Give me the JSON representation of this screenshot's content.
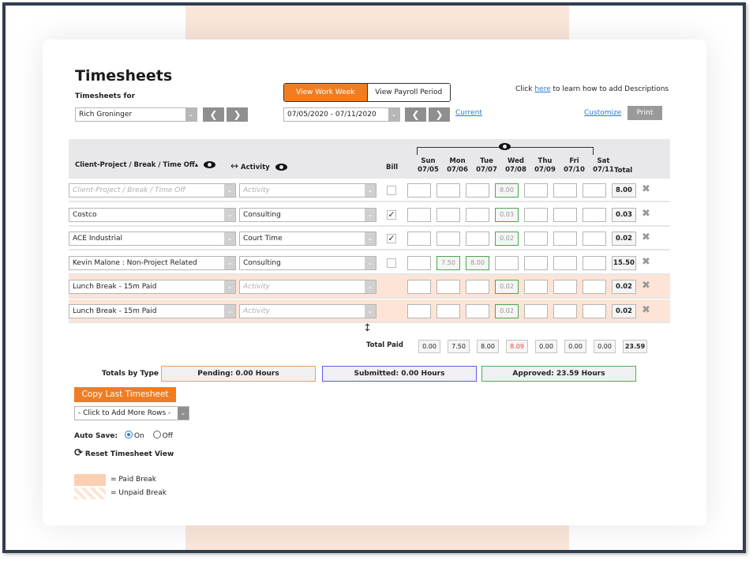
{
  "page": {
    "title": "Timesheets",
    "timesheets_for_label": "Timesheets for",
    "employee_selected": "Rich Groninger",
    "view_toggle": {
      "work_week": "View Work Week",
      "payroll_period": "View Payroll Period",
      "active": "work_week"
    },
    "date_range": "07/05/2020 - 07/11/2020",
    "current_link": "Current",
    "help": {
      "prefix": "Click",
      "link": "here",
      "suffix": "to learn how to add Descriptions"
    },
    "customize_link": "Customize",
    "print_label": "Print"
  },
  "grid": {
    "headers": {
      "client_project": "Client-Project / Break / Time Off",
      "sort_indicator": "▴",
      "activity": "Activity",
      "bill": "Bill",
      "total": "Total",
      "days": [
        {
          "day": "Sun",
          "date": "07/05"
        },
        {
          "day": "Mon",
          "date": "07/06"
        },
        {
          "day": "Tue",
          "date": "07/07"
        },
        {
          "day": "Wed",
          "date": "07/08"
        },
        {
          "day": "Thu",
          "date": "07/09"
        },
        {
          "day": "Fri",
          "date": "07/10"
        },
        {
          "day": "Sat",
          "date": "07/11"
        }
      ]
    },
    "placeholders": {
      "client_project": "Client-Project / Break / Time Off",
      "activity": "Activity"
    },
    "rows": [
      {
        "client": "",
        "activity": "",
        "bill": false,
        "show_bill": true,
        "break": false,
        "hours": [
          "",
          "",
          "",
          "8.00",
          "",
          "",
          ""
        ],
        "approved": [
          false,
          false,
          false,
          true,
          false,
          false,
          false
        ],
        "total": "8.00"
      },
      {
        "client": "Costco",
        "activity": "Consulting",
        "bill": true,
        "show_bill": true,
        "break": false,
        "hours": [
          "",
          "",
          "",
          "0.03",
          "",
          "",
          ""
        ],
        "approved": [
          false,
          false,
          false,
          true,
          false,
          false,
          false
        ],
        "total": "0.03"
      },
      {
        "client": "ACE Industrial",
        "activity": "Court Time",
        "bill": true,
        "show_bill": true,
        "break": false,
        "hours": [
          "",
          "",
          "",
          "0.02",
          "",
          "",
          ""
        ],
        "approved": [
          false,
          false,
          false,
          true,
          false,
          false,
          false
        ],
        "total": "0.02"
      },
      {
        "client": "Kevin Malone : Non-Project Related",
        "activity": "Consulting",
        "bill": false,
        "show_bill": true,
        "break": false,
        "hours": [
          "",
          "7.50",
          "8.00",
          "",
          "",
          "",
          ""
        ],
        "approved": [
          false,
          true,
          true,
          false,
          false,
          false,
          false
        ],
        "total": "15.50"
      },
      {
        "client": "Lunch Break - 15m Paid",
        "activity": "",
        "bill": false,
        "show_bill": false,
        "break": true,
        "hours": [
          "",
          "",
          "",
          "0.02",
          "",
          "",
          ""
        ],
        "approved": [
          false,
          false,
          false,
          true,
          false,
          false,
          false
        ],
        "total": "0.02"
      },
      {
        "client": "Lunch Break - 15m Paid",
        "activity": "",
        "bill": false,
        "show_bill": false,
        "break": true,
        "hours": [
          "",
          "",
          "",
          "0.02",
          "",
          "",
          ""
        ],
        "approved": [
          false,
          false,
          false,
          true,
          false,
          false,
          false
        ],
        "total": "0.02"
      }
    ],
    "total_paid": {
      "label": "Total Paid",
      "days": [
        "0.00",
        "7.50",
        "8.00",
        "8.09",
        "0.00",
        "0.00",
        "0.00"
      ],
      "highlight_index": 3,
      "highlight_color": "#e8473a",
      "total": "23.59"
    }
  },
  "totals_by_type": {
    "label": "Totals by Type",
    "pending": "Pending: 0.00 Hours",
    "submitted": "Submitted: 0.00 Hours",
    "approved": "Approved: 23.59 Hours",
    "colors": {
      "pending": "#f0a060",
      "submitted": "#5b5be6",
      "approved": "#4caf50"
    }
  },
  "actions": {
    "copy_last": "Copy Last Timesheet",
    "add_rows": "- Click to Add More Rows -",
    "auto_save_label": "Auto Save:",
    "auto_save_on": "On",
    "auto_save_off": "Off",
    "auto_save_value": "On",
    "reset_view": "Reset Timesheet View"
  },
  "legend": {
    "paid": "= Paid Break",
    "unpaid": "= Unpaid Break"
  },
  "colors": {
    "accent": "#f07d22",
    "break_row": "#fde4d6",
    "approved_cell": "#49a84b",
    "link": "#2a7bd0"
  }
}
